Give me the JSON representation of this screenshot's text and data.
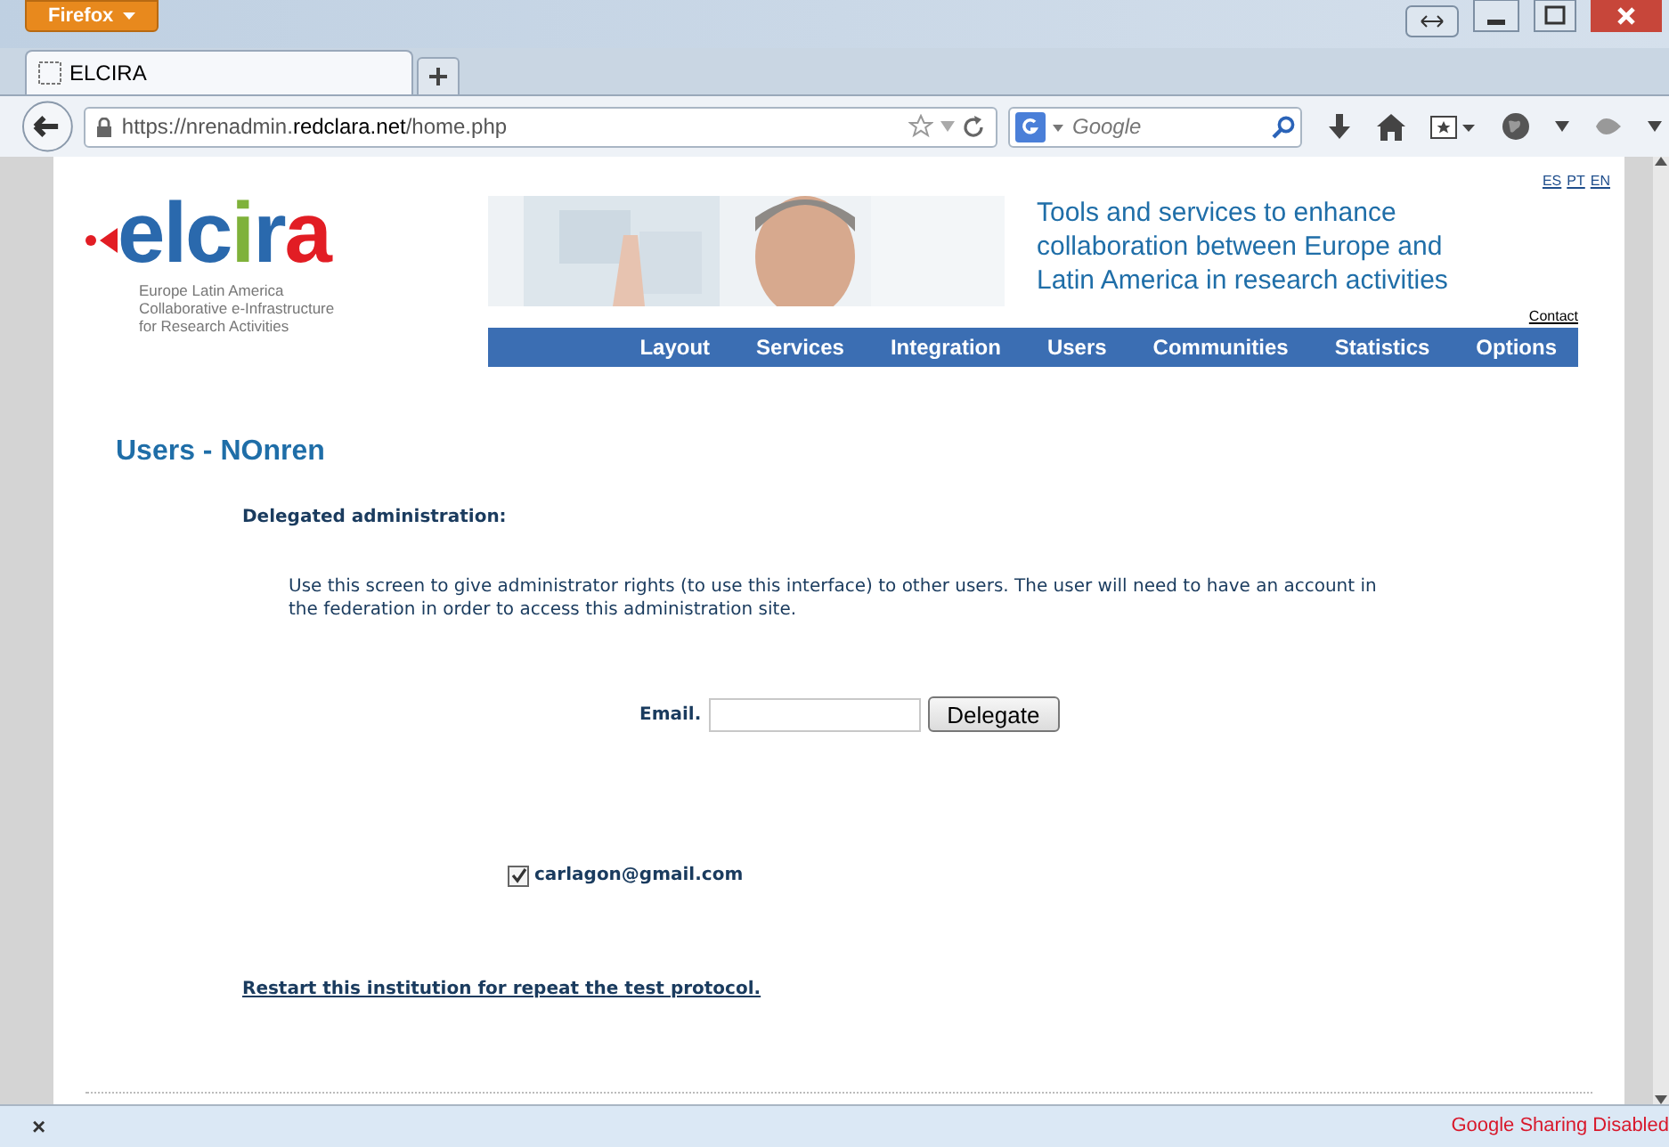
{
  "browser": {
    "menu_button": "Firefox",
    "tab": {
      "title": "ELCIRA"
    },
    "url": {
      "host_prefix": "https://nrenadmin.",
      "host": "redclara.net",
      "path": "/home.php"
    },
    "search": {
      "placeholder": "Google"
    }
  },
  "header": {
    "languages": [
      "ES",
      "PT",
      "EN"
    ],
    "logo": {
      "wordmark": "elcira",
      "subtitle": [
        "Europe Latin America",
        "Collaborative e-Infrastructure",
        "for Research Activities"
      ]
    },
    "tagline": "Tools and services to enhance collaboration between Europe and Latin America in research activities",
    "contact": "Contact"
  },
  "nav": [
    "Layout",
    "Services",
    "Integration",
    "Users",
    "Communities",
    "Statistics",
    "Options"
  ],
  "page": {
    "title": "Users - NOnren",
    "section": "Delegated administration:",
    "description": "Use this screen to give administrator rights (to use this interface) to other users. The user will need to have an account in the federation in order to access this administration site.",
    "email_label": "Email.",
    "delegate_button": "Delegate",
    "users": [
      {
        "email": "carlagon@gmail.com",
        "checked": true
      }
    ],
    "restart_link": "Restart this institution for repeat the test protocol."
  },
  "status_bar": {
    "close": "×",
    "message": "Google Sharing Disabled"
  }
}
